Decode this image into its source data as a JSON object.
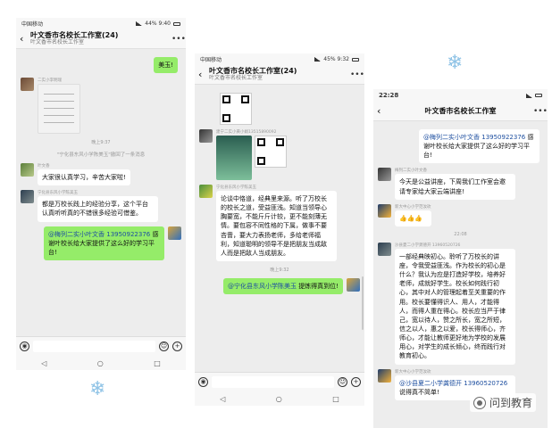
{
  "phone1": {
    "status_left": "中国移动",
    "status_right": "44% 9:40",
    "title": "叶文香市名校长工作室(24)",
    "subtitle": "叶文香市名校长工作室",
    "top_partial": "美玉!",
    "sender1": "二实小李明瑞",
    "ts1": "晚上9:37",
    "sys1": "\"宁化县东风小学陈美玉\"撤回了一条消息",
    "sender2": "叶文香",
    "msg2": "大家很认真学习，辛苦大家啦!",
    "sender3": "宁化县东风小学陈美玉",
    "msg3": "都是万校长践上的经验分享，这个平台认真听听真的不错很多经验可借鉴。",
    "msg4_mention": "@梅列二实小叶文香",
    "msg4_tel": "13950922376",
    "msg4_text": "感谢叶校长给大家提供了这么好的学习平台!"
  },
  "phone2": {
    "status_left": "中国移动",
    "status_right": "45% 9:32",
    "title": "叶文香市名校长工作室(24)",
    "subtitle": "叶文香市名校长工作室",
    "sender1": "建宁二实小黄小娟13515890092",
    "sender2": "宁化县东风小学陈美玉",
    "msg2": "论谈中恪道，经典里来源。听了万校长的校长之道，受益匪浅。知道当领导心胸要宽，不能斤斤计较，更不能刻薄无情。要包容不同性格的下属，做事不要吝啬，要大力表扬老师，多给老师福利，知道聪明的领导不是把朋友当成敌人而是把敌人当成朋友。",
    "ts1": "晚上9:32",
    "msg3_mention": "@宁化县东风小学陈美玉",
    "msg3_text": "提炼得真到位!"
  },
  "phone3": {
    "status_left": "22:28",
    "status_right": "",
    "title": "叶文香市名校长工作室",
    "top_partial": "@梅列二实小叶文香",
    "top_tel": "13950922376",
    "top_text": "感谢叶校长给大家提供了这么好的学习平台!",
    "sender1": "梅列二实小叶文香",
    "msg1": "今天是公益讲座，下周我们工作室会邀请专家给大家云端讲座!",
    "sender2": "新大中心小学范汝玫",
    "ts1": "22:08",
    "sender3": "沙县夏二小学龚德开 13960520726",
    "msg3": "一部经典映初心。聆听了万校长的讲座，令我受益匪浅。作为校长的初心是什么？我认为应是打造好学校，培养好老师，成就好学生。校长如何践行初心，其中对人的管理起着至关重要的作用。校长要懂得识人、用人，才能得人，而得人重在得心。校长应当严于律己，宽以待人，赞之所长，宽之所短，信之以人，惠之以爱，校长得师心，齐师心，才能让教师更好地为学校的发展用心，对学生的成长倾心，终而践行对教育初心。",
    "sender4": "新大中心小学范汝玫",
    "msg4_mention": "@沙县夏二小学龚德开",
    "msg4_tel": "13960520726",
    "msg4_text": "说得真不简单!"
  },
  "watermark": "问到教育"
}
